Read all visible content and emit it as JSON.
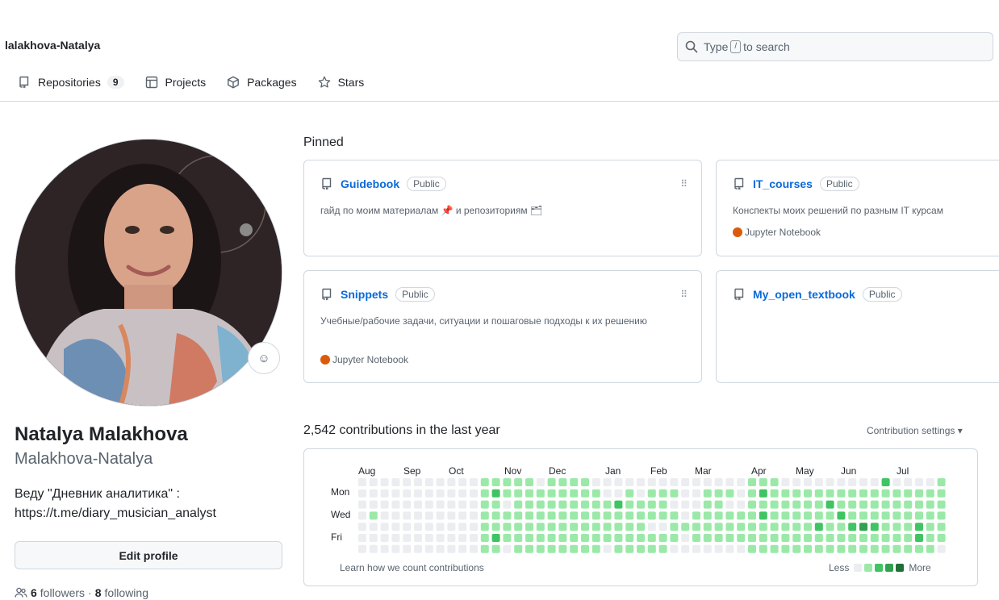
{
  "header": {
    "username": "lalakhova-Natalya",
    "search_placeholder": "Type",
    "search_key": "/",
    "search_suffix": "to search"
  },
  "tabs": [
    {
      "label": "Repositories",
      "count": "9",
      "icon": "repo-icon"
    },
    {
      "label": "Projects",
      "icon": "table-icon"
    },
    {
      "label": "Packages",
      "icon": "package-icon"
    },
    {
      "label": "Stars",
      "icon": "star-icon"
    }
  ],
  "profile": {
    "full_name": "Natalya Malakhova",
    "login": "Malakhova-Natalya",
    "bio": "Веду \"Дневник аналитика\" : https://t.me/diary_musician_analyst",
    "edit_label": "Edit profile",
    "followers_count": "6",
    "followers_label": "followers",
    "separator": "·",
    "following_count": "8",
    "following_label": "following"
  },
  "pinned": {
    "title": "Pinned",
    "repos": [
      {
        "name": "Guidebook",
        "visibility": "Public",
        "description": "гайд по моим материалам 📌 и репозиториям 🗂",
        "language": "",
        "lang_color": ""
      },
      {
        "name": "IT_courses",
        "visibility": "Public",
        "description": "Конспекты моих решений по разным IT курсам",
        "language": "Jupyter Notebook",
        "lang_color": "#DA5B0B"
      },
      {
        "name": "Snippets",
        "visibility": "Public",
        "description": "Учебные/рабочие задачи, ситуации и пошаговые подходы к их решению",
        "language": "Jupyter Notebook",
        "lang_color": "#DA5B0B"
      },
      {
        "name": "My_open_textbook",
        "visibility": "Public",
        "description": "",
        "language": "",
        "lang_color": ""
      }
    ]
  },
  "contributions": {
    "title": "2,542 contributions in the last year",
    "settings_label": "Contribution settings ▾",
    "months": [
      "Aug",
      "Sep",
      "Oct",
      "Nov",
      "Dec",
      "Jan",
      "Feb",
      "Mar",
      "Apr",
      "May",
      "Jun",
      "Jul"
    ],
    "days": [
      "Mon",
      "Wed",
      "Fri"
    ],
    "learn_label": "Learn how we count contributions",
    "less_label": "Less",
    "more_label": "More",
    "colors": [
      "#ebedf0",
      "#9be9a8",
      "#40c463",
      "#30a14e",
      "#216e39"
    ],
    "weeks": [
      [
        0,
        0,
        0,
        0,
        0,
        0,
        0
      ],
      [
        0,
        0,
        0,
        1,
        0,
        0,
        0
      ],
      [
        0,
        0,
        0,
        0,
        0,
        0,
        0
      ],
      [
        0,
        0,
        0,
        0,
        0,
        0,
        0
      ],
      [
        0,
        0,
        0,
        0,
        0,
        0,
        0
      ],
      [
        0,
        0,
        0,
        0,
        0,
        0,
        0
      ],
      [
        0,
        0,
        0,
        0,
        0,
        0,
        0
      ],
      [
        0,
        0,
        0,
        0,
        0,
        0,
        0
      ],
      [
        0,
        0,
        0,
        0,
        0,
        0,
        0
      ],
      [
        0,
        0,
        0,
        0,
        0,
        0,
        0
      ],
      [
        0,
        0,
        0,
        0,
        0,
        0,
        0
      ],
      [
        1,
        1,
        1,
        1,
        1,
        1,
        1
      ],
      [
        1,
        2,
        1,
        1,
        1,
        2,
        1
      ],
      [
        1,
        1,
        0,
        1,
        1,
        1,
        0
      ],
      [
        1,
        1,
        1,
        1,
        1,
        1,
        1
      ],
      [
        1,
        1,
        1,
        1,
        1,
        1,
        1
      ],
      [
        0,
        1,
        1,
        1,
        1,
        1,
        1
      ],
      [
        1,
        1,
        1,
        1,
        1,
        1,
        1
      ],
      [
        1,
        1,
        1,
        1,
        1,
        1,
        1
      ],
      [
        1,
        1,
        1,
        1,
        1,
        1,
        1
      ],
      [
        1,
        1,
        1,
        1,
        1,
        1,
        1
      ],
      [
        0,
        1,
        1,
        1,
        1,
        1,
        1
      ],
      [
        0,
        0,
        1,
        1,
        1,
        1,
        0
      ],
      [
        0,
        0,
        2,
        1,
        1,
        1,
        1
      ],
      [
        0,
        1,
        1,
        1,
        1,
        1,
        1
      ],
      [
        0,
        0,
        1,
        1,
        1,
        1,
        1
      ],
      [
        0,
        1,
        1,
        1,
        0,
        1,
        1
      ],
      [
        0,
        1,
        1,
        1,
        0,
        1,
        1
      ],
      [
        0,
        1,
        0,
        1,
        1,
        1,
        0
      ],
      [
        0,
        0,
        0,
        0,
        1,
        0,
        0
      ],
      [
        0,
        0,
        0,
        1,
        1,
        1,
        0
      ],
      [
        0,
        1,
        1,
        1,
        1,
        1,
        0
      ],
      [
        0,
        1,
        1,
        1,
        1,
        1,
        0
      ],
      [
        0,
        1,
        0,
        1,
        1,
        1,
        0
      ],
      [
        0,
        0,
        0,
        1,
        1,
        1,
        0
      ],
      [
        1,
        1,
        1,
        1,
        1,
        1,
        1
      ],
      [
        1,
        2,
        1,
        2,
        1,
        1,
        1
      ],
      [
        1,
        1,
        1,
        1,
        1,
        1,
        1
      ],
      [
        0,
        1,
        1,
        1,
        1,
        1,
        1
      ],
      [
        0,
        1,
        1,
        1,
        1,
        1,
        1
      ],
      [
        0,
        1,
        1,
        1,
        1,
        1,
        1
      ],
      [
        0,
        1,
        1,
        1,
        2,
        1,
        1
      ],
      [
        0,
        1,
        2,
        1,
        1,
        1,
        1
      ],
      [
        0,
        1,
        1,
        2,
        1,
        1,
        1
      ],
      [
        0,
        1,
        1,
        1,
        2,
        1,
        1
      ],
      [
        0,
        1,
        1,
        1,
        3,
        1,
        1
      ],
      [
        0,
        1,
        1,
        1,
        2,
        1,
        1
      ],
      [
        2,
        1,
        1,
        1,
        1,
        1,
        1
      ],
      [
        0,
        1,
        1,
        1,
        1,
        1,
        1
      ],
      [
        0,
        1,
        1,
        1,
        1,
        1,
        1
      ],
      [
        0,
        1,
        1,
        1,
        2,
        2,
        1
      ],
      [
        0,
        1,
        1,
        1,
        1,
        1,
        1
      ],
      [
        1,
        1,
        1,
        1,
        1,
        1,
        0
      ]
    ]
  }
}
